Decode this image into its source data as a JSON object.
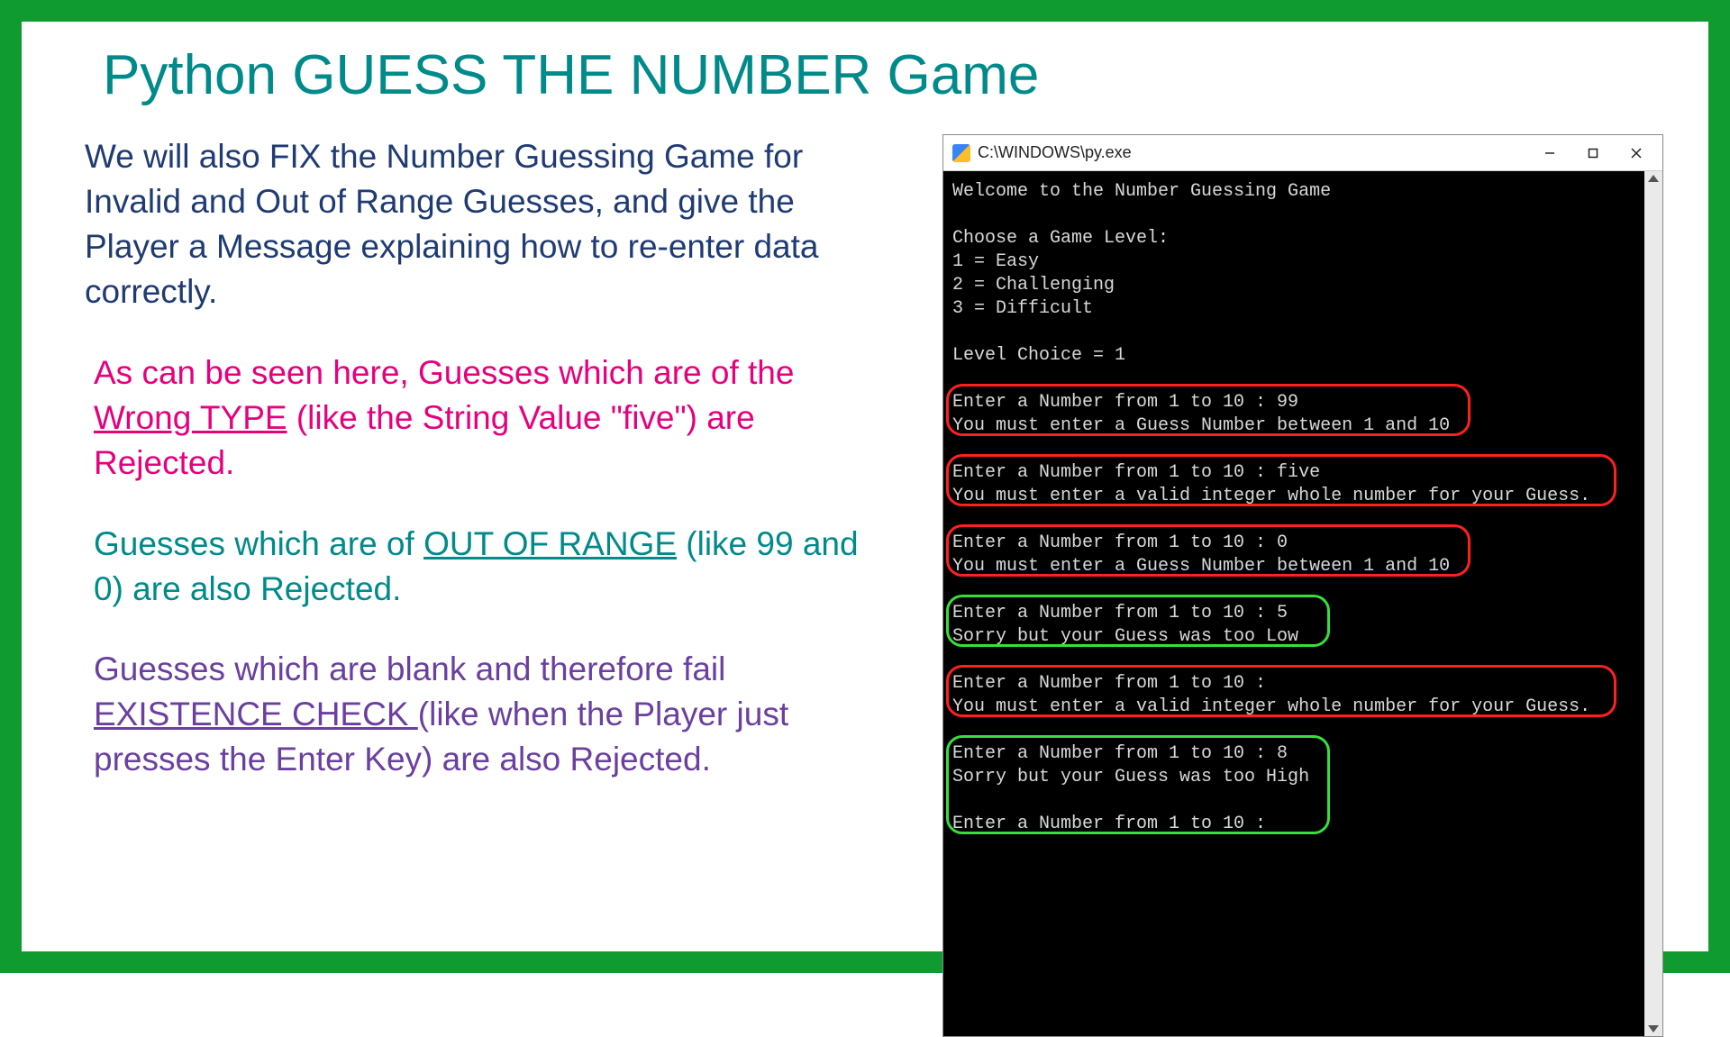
{
  "title": "Python GUESS THE NUMBER Game",
  "left": {
    "p1": "We will also FIX the Number Guessing Game for Invalid and Out of Range Guesses, and give the Player a Message explaining how to re-enter data correctly.",
    "p2a": "As can be seen here, Guesses which are of the ",
    "p2u": "Wrong TYPE",
    "p2b": " (like the String Value \"five\") are Rejected.",
    "p3a": "Guesses which are of ",
    "p3u": "OUT OF RANGE",
    "p3b": " (like 99 and 0) are also Rejected.",
    "p4a": "Guesses which are blank and therefore fail ",
    "p4u": "EXISTENCE CHECK ",
    "p4b": "(like when the Player just presses the Enter Key) are also Rejected."
  },
  "window": {
    "title": "C:\\WINDOWS\\py.exe"
  },
  "console": {
    "l01": "Welcome to the Number Guessing Game",
    "l02": "",
    "l03": "Choose a Game Level:",
    "l04": "1 = Easy",
    "l05": "2 = Challenging",
    "l06": "3 = Difficult",
    "l07": "",
    "l08": "Level Choice = 1",
    "l09": "",
    "l10": "Enter a Number from 1 to 10 : 99",
    "l11": "You must enter a Guess Number between 1 and 10",
    "l12": "",
    "l13": "Enter a Number from 1 to 10 : five",
    "l14": "You must enter a valid integer whole number for your Guess.",
    "l15": "",
    "l16": "Enter a Number from 1 to 10 : 0",
    "l17": "You must enter a Guess Number between 1 and 10",
    "l18": "",
    "l19": "Enter a Number from 1 to 10 : 5",
    "l20": "Sorry but your Guess was too Low",
    "l21": "",
    "l22": "Enter a Number from 1 to 10 :",
    "l23": "You must enter a valid integer whole number for your Guess.",
    "l24": "",
    "l25": "Enter a Number from 1 to 10 : 8",
    "l26": "Sorry but your Guess was too High",
    "l27": "",
    "l28": "Enter a Number from 1 to 10 :"
  }
}
